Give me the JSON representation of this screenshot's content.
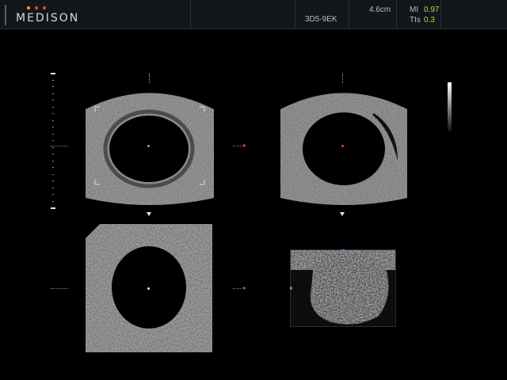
{
  "header": {
    "logo": "MEDISON",
    "logo_dot_colors": [
      "#e8a317",
      "#e04848",
      "#e04848"
    ],
    "probe": "3D5-9EK",
    "depth": "4.6cm",
    "mi_label": "MI",
    "mi_value": "0.97",
    "tis_label": "TIs",
    "tis_value": "0.3",
    "value_color": "#9fe04f"
  },
  "panes": [
    {
      "name": "pane-a-sagittal",
      "icon": "ultrasound-plane-a"
    },
    {
      "name": "pane-b-transverse",
      "icon": "ultrasound-plane-b"
    },
    {
      "name": "pane-c-coronal",
      "icon": "ultrasound-plane-c"
    },
    {
      "name": "pane-3d-render",
      "icon": "ultrasound-3d-render"
    }
  ],
  "colors": {
    "marker_red": "#e04848",
    "center_green": "#4fd06f",
    "center_red": "#e04848"
  }
}
